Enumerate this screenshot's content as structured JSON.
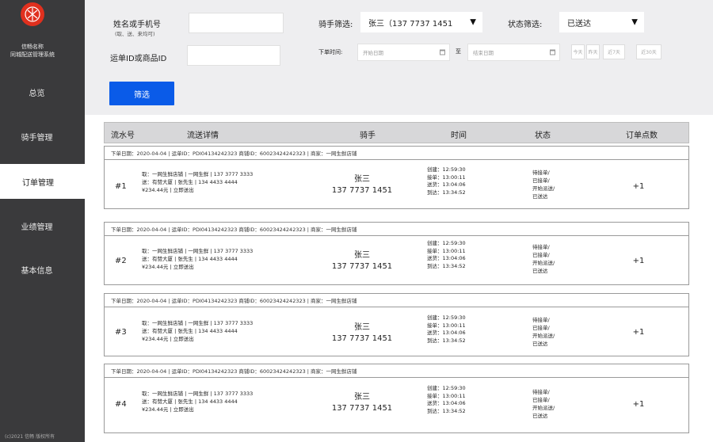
{
  "sidebar": {
    "brand_line1": "信畅名称",
    "brand_line2": "同城配送管理系统",
    "items": [
      {
        "label": "总览"
      },
      {
        "label": "骑手管理"
      },
      {
        "label": "订单管理"
      },
      {
        "label": "业绩管理"
      },
      {
        "label": "基本信息"
      }
    ],
    "footer": "(c)2021 信畅 版权所有"
  },
  "filter": {
    "name_phone_label": "姓名或手机号",
    "name_phone_hint": "(取、送、来均可)",
    "order_id_label": "运单ID或商品ID",
    "rider_label": "骑手筛选:",
    "rider_value": "张三（137 7737 1451",
    "status_label": "状态筛选:",
    "status_value": "已送达",
    "order_time_label": "下单时间:",
    "start_date_placeholder": "开始日期",
    "end_date_placeholder": "结束日期",
    "date_sep": "至",
    "quick_buttons": [
      "今天",
      "昨天",
      "近7天",
      "近30天"
    ],
    "search_button": "筛选"
  },
  "table": {
    "headers": {
      "serial": "流水号",
      "detail": "流送详情",
      "rider": "骑手",
      "time": "时间",
      "status": "状态",
      "count": "订单点数"
    },
    "orders": [
      {
        "meta": "下单日期：2020-04-04  |  运单ID：PDI04134242323   商铺ID：60023424242323   |  商家：一网生鲜店铺",
        "index": "#1",
        "from": "取：一网生鲜店铺 | 一网生鲜 | 137 3777 3333",
        "to": "送：有赞大厦 | 张先生 | 134 4433 4444",
        "price": "¥234.44元 | 立即送出",
        "rider_name": "张三",
        "rider_phone": "137 7737 1451",
        "created": "创建：12:59:30",
        "accepted": "接单：13:00:11",
        "delivering": "送货：13:04:06",
        "arrived": "到达：13:34:52",
        "status_lines": [
          "待接单/",
          "已接单/",
          "开始派送/",
          "已送达"
        ],
        "count": "+1"
      },
      {
        "meta": "下单日期：2020-04-04  |  运单ID：PDI04134242323   商铺ID：60023424242323   |  商家：一网生鲜店铺",
        "index": "#2",
        "from": "取：一网生鲜店铺 | 一网生鲜 | 137 3777 3333",
        "to": "送：有赞大厦 | 张先生 | 134 4433 4444",
        "price": "¥234.44元 | 立即送出",
        "rider_name": "张三",
        "rider_phone": "137 7737 1451",
        "created": "创建：12:59:30",
        "accepted": "接单：13:00:11",
        "delivering": "送货：13:04:06",
        "arrived": "到达：13:34:52",
        "status_lines": [
          "待接单/",
          "已接单/",
          "开始派送/",
          "已送达"
        ],
        "count": "+1"
      },
      {
        "meta": "下单日期：2020-04-04  |  运单ID：PDI04134242323   商铺ID：60023424242323   |  商家：一网生鲜店铺",
        "index": "#3",
        "from": "取：一网生鲜店铺 | 一网生鲜 | 137 3777 3333",
        "to": "送：有赞大厦 | 张先生 | 134 4433 4444",
        "price": "¥234.44元 | 立即送出",
        "rider_name": "张三",
        "rider_phone": "137 7737 1451",
        "created": "创建：12:59:30",
        "accepted": "接单：13:00:11",
        "delivering": "送货：13:04:06",
        "arrived": "到达：13:34:52",
        "status_lines": [
          "待接单/",
          "已接单/",
          "开始派送/",
          "已送达"
        ],
        "count": "+1"
      },
      {
        "meta": "下单日期：2020-04-04  |  运单ID：PDI04134242323   商铺ID：60023424242323   |  商家：一网生鲜店铺",
        "index": "#4",
        "from": "取：一网生鲜店铺 | 一网生鲜 | 137 3777 3333",
        "to": "送：有赞大厦 | 张先生 | 134 4433 4444",
        "price": "¥234.44元 | 立即送出",
        "rider_name": "张三",
        "rider_phone": "137 7737 1451",
        "created": "创建：12:59:30",
        "accepted": "接单：13:00:11",
        "delivering": "送货：13:04:06",
        "arrived": "到达：13:34:52",
        "status_lines": [
          "待接单/",
          "已接单/",
          "开始派送/",
          "已送达"
        ],
        "count": "+1"
      }
    ]
  },
  "colors": {
    "sidebar_bg": "#3a3a3c",
    "logo_red": "#e0301e",
    "primary_blue": "#0a5be8",
    "filter_bg": "#eeeef0",
    "header_bg": "#d7d7d9"
  },
  "icons": {
    "logo": "logo-icon",
    "dropdown": "chevron-down-icon",
    "calendar": "calendar-icon"
  }
}
